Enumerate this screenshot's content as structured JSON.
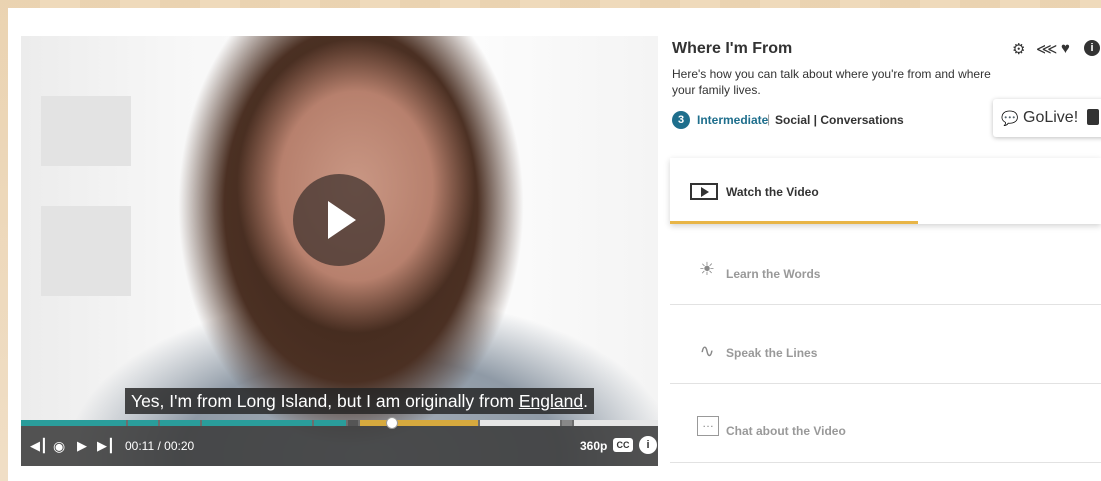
{
  "lesson": {
    "title": "Where I'm From",
    "description": "Here's how you can talk about where you're from and where your family lives.",
    "level_number": "3",
    "level_name": "Intermediate",
    "separator": "|",
    "tags": "Social | Conversations"
  },
  "video": {
    "subtitle_before": "Yes, I'm from Long Island, but I am originally from ",
    "subtitle_link": "England",
    "subtitle_after": ".",
    "time": "00:11 / 00:20",
    "quality": "360p",
    "cc_label": "CC",
    "info_label": "i",
    "progress_fraction": 0.55
  },
  "golive": {
    "label": "GoLive!"
  },
  "steps": [
    {
      "label": "Watch the Video",
      "icon": "play-box-icon"
    },
    {
      "label": "Learn the Words",
      "icon": "lightbulb-icon"
    },
    {
      "label": "Speak the Lines",
      "icon": "speak-icon"
    },
    {
      "label": "Chat about the Video",
      "icon": "chat-bubble-icon"
    }
  ],
  "icons": {
    "settings": "gear-icon",
    "share": "share-icon",
    "favorite": "heart-icon",
    "info": "info-icon"
  },
  "colors": {
    "accent": "#1e6e8c",
    "progress_teal": "#2a9d9b",
    "progress_gold": "#d6a93e",
    "active_underline": "#e8b547"
  }
}
